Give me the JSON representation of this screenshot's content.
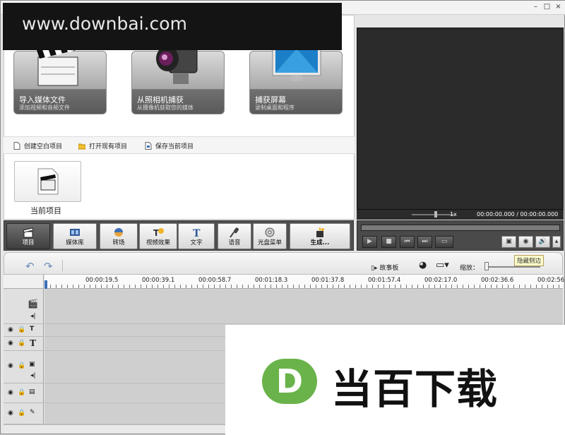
{
  "watermark": "www.downbai.com",
  "cards": [
    {
      "title": "导入媒体文件",
      "subtitle": "添加视频和音频文件"
    },
    {
      "title": "从照相机捕获",
      "subtitle": "从摄像机获取您的媒体"
    },
    {
      "title": "捕获屏幕",
      "subtitle": "录制桌面和程序"
    }
  ],
  "project_toolbar": {
    "new": "创建空白项目",
    "open": "打开现有项目",
    "save": "保存当前项目"
  },
  "current_project_label": "当前项目",
  "preview": {
    "speed": "1x",
    "time": "00:00:00.000 / 00:00:00.000"
  },
  "main_tabs": [
    "项目",
    "媒体库",
    "转场",
    "视频效果",
    "文字",
    "语音",
    "光盘菜单",
    "生成..."
  ],
  "edit_toolbar": {
    "storyboard": "故事板",
    "zoom_label": "缩放：",
    "tooltip": "隐藏侧边"
  },
  "ruler_ticks": [
    "00:00:19.5",
    "00:00:39.1",
    "00:00:58.7",
    "00:01:18.3",
    "00:01:37.8",
    "00:01:57.4",
    "00:02:17.0",
    "00:02:36.6",
    "00:02:56."
  ],
  "banner": {
    "logo_letter": "D",
    "text": "当百下载"
  },
  "colors": {
    "dark_panel": "#2b2b2b",
    "tab_bar": "#4f4f4f",
    "banner_green": "#6ab34a"
  }
}
